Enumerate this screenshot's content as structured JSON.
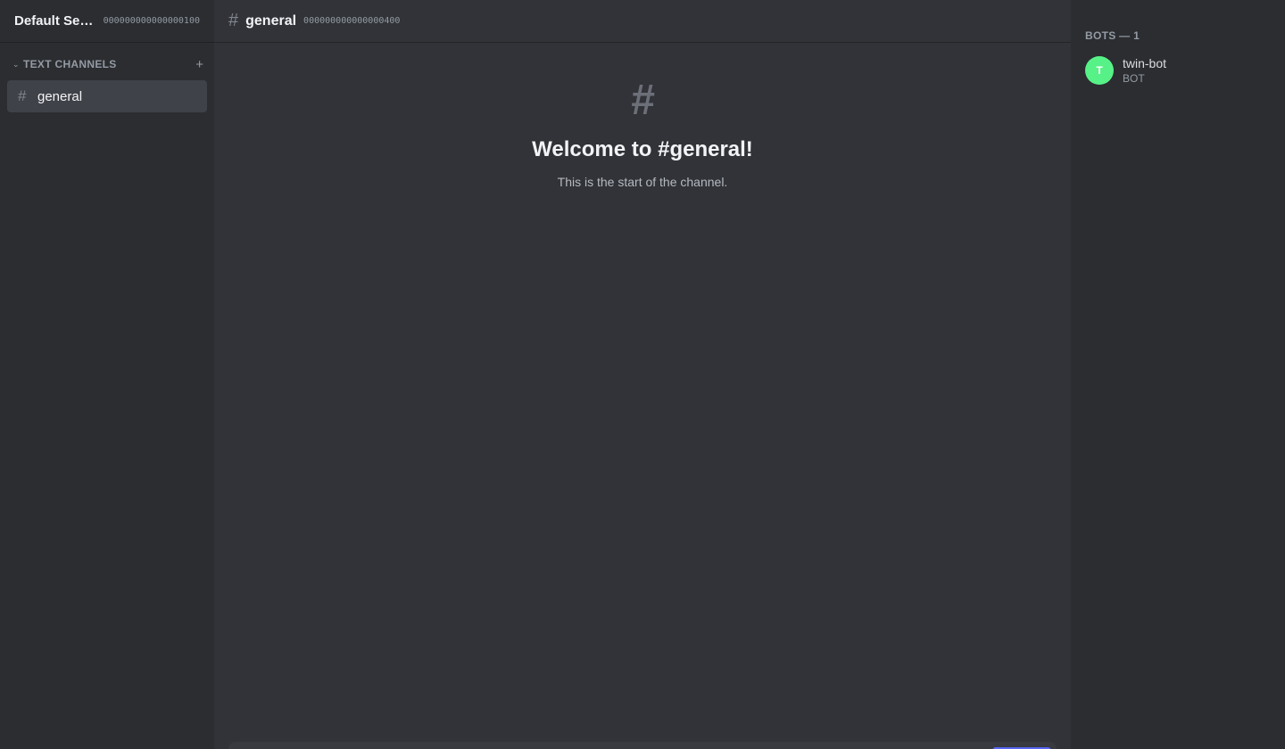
{
  "server": {
    "name": "Default Server",
    "id": "000000000000000100"
  },
  "sidebar": {
    "category": {
      "caret_icon": "chevron-down-icon",
      "label": "TEXT CHANNELS",
      "add_icon": "+"
    },
    "channels": [
      {
        "hash": "#",
        "label": "general",
        "selected": true
      }
    ]
  },
  "channel_header": {
    "hash": "#",
    "name": "general",
    "id": "000000000000000400"
  },
  "welcome": {
    "hash": "#",
    "title": "Welcome to #general!",
    "subtitle": "This is the start of the channel."
  },
  "members": {
    "header": "BOTS — 1",
    "list": [
      {
        "avatar_letter": "T",
        "avatar_color": "#57f287",
        "name": "twin-bot",
        "tag": "BOT"
      }
    ]
  },
  "colors": {
    "accent": "#5865f2",
    "sidebar_bg": "#2b2d31",
    "main_bg": "#313338"
  }
}
